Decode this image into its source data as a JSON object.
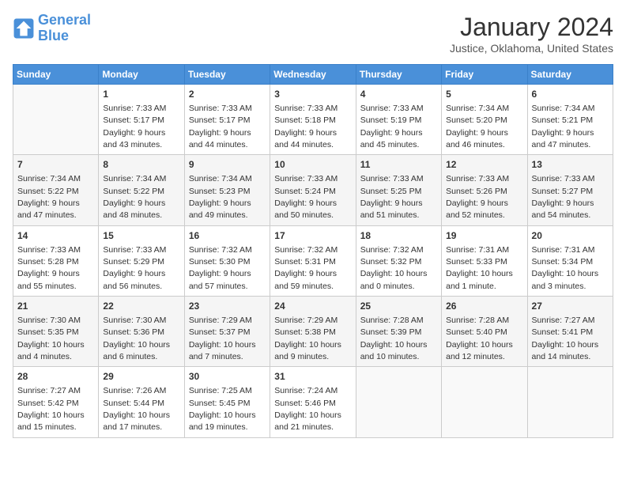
{
  "header": {
    "logo": {
      "line1": "General",
      "line2": "Blue"
    },
    "title": "January 2024",
    "location": "Justice, Oklahoma, United States"
  },
  "days_of_week": [
    "Sunday",
    "Monday",
    "Tuesday",
    "Wednesday",
    "Thursday",
    "Friday",
    "Saturday"
  ],
  "weeks": [
    [
      {
        "num": "",
        "sunrise": "",
        "sunset": "",
        "daylight": "",
        "empty": true
      },
      {
        "num": "1",
        "sunrise": "Sunrise: 7:33 AM",
        "sunset": "Sunset: 5:17 PM",
        "daylight": "Daylight: 9 hours and 43 minutes."
      },
      {
        "num": "2",
        "sunrise": "Sunrise: 7:33 AM",
        "sunset": "Sunset: 5:17 PM",
        "daylight": "Daylight: 9 hours and 44 minutes."
      },
      {
        "num": "3",
        "sunrise": "Sunrise: 7:33 AM",
        "sunset": "Sunset: 5:18 PM",
        "daylight": "Daylight: 9 hours and 44 minutes."
      },
      {
        "num": "4",
        "sunrise": "Sunrise: 7:33 AM",
        "sunset": "Sunset: 5:19 PM",
        "daylight": "Daylight: 9 hours and 45 minutes."
      },
      {
        "num": "5",
        "sunrise": "Sunrise: 7:34 AM",
        "sunset": "Sunset: 5:20 PM",
        "daylight": "Daylight: 9 hours and 46 minutes."
      },
      {
        "num": "6",
        "sunrise": "Sunrise: 7:34 AM",
        "sunset": "Sunset: 5:21 PM",
        "daylight": "Daylight: 9 hours and 47 minutes."
      }
    ],
    [
      {
        "num": "7",
        "sunrise": "Sunrise: 7:34 AM",
        "sunset": "Sunset: 5:22 PM",
        "daylight": "Daylight: 9 hours and 47 minutes."
      },
      {
        "num": "8",
        "sunrise": "Sunrise: 7:34 AM",
        "sunset": "Sunset: 5:22 PM",
        "daylight": "Daylight: 9 hours and 48 minutes."
      },
      {
        "num": "9",
        "sunrise": "Sunrise: 7:34 AM",
        "sunset": "Sunset: 5:23 PM",
        "daylight": "Daylight: 9 hours and 49 minutes."
      },
      {
        "num": "10",
        "sunrise": "Sunrise: 7:33 AM",
        "sunset": "Sunset: 5:24 PM",
        "daylight": "Daylight: 9 hours and 50 minutes."
      },
      {
        "num": "11",
        "sunrise": "Sunrise: 7:33 AM",
        "sunset": "Sunset: 5:25 PM",
        "daylight": "Daylight: 9 hours and 51 minutes."
      },
      {
        "num": "12",
        "sunrise": "Sunrise: 7:33 AM",
        "sunset": "Sunset: 5:26 PM",
        "daylight": "Daylight: 9 hours and 52 minutes."
      },
      {
        "num": "13",
        "sunrise": "Sunrise: 7:33 AM",
        "sunset": "Sunset: 5:27 PM",
        "daylight": "Daylight: 9 hours and 54 minutes."
      }
    ],
    [
      {
        "num": "14",
        "sunrise": "Sunrise: 7:33 AM",
        "sunset": "Sunset: 5:28 PM",
        "daylight": "Daylight: 9 hours and 55 minutes."
      },
      {
        "num": "15",
        "sunrise": "Sunrise: 7:33 AM",
        "sunset": "Sunset: 5:29 PM",
        "daylight": "Daylight: 9 hours and 56 minutes."
      },
      {
        "num": "16",
        "sunrise": "Sunrise: 7:32 AM",
        "sunset": "Sunset: 5:30 PM",
        "daylight": "Daylight: 9 hours and 57 minutes."
      },
      {
        "num": "17",
        "sunrise": "Sunrise: 7:32 AM",
        "sunset": "Sunset: 5:31 PM",
        "daylight": "Daylight: 9 hours and 59 minutes."
      },
      {
        "num": "18",
        "sunrise": "Sunrise: 7:32 AM",
        "sunset": "Sunset: 5:32 PM",
        "daylight": "Daylight: 10 hours and 0 minutes."
      },
      {
        "num": "19",
        "sunrise": "Sunrise: 7:31 AM",
        "sunset": "Sunset: 5:33 PM",
        "daylight": "Daylight: 10 hours and 1 minute."
      },
      {
        "num": "20",
        "sunrise": "Sunrise: 7:31 AM",
        "sunset": "Sunset: 5:34 PM",
        "daylight": "Daylight: 10 hours and 3 minutes."
      }
    ],
    [
      {
        "num": "21",
        "sunrise": "Sunrise: 7:30 AM",
        "sunset": "Sunset: 5:35 PM",
        "daylight": "Daylight: 10 hours and 4 minutes."
      },
      {
        "num": "22",
        "sunrise": "Sunrise: 7:30 AM",
        "sunset": "Sunset: 5:36 PM",
        "daylight": "Daylight: 10 hours and 6 minutes."
      },
      {
        "num": "23",
        "sunrise": "Sunrise: 7:29 AM",
        "sunset": "Sunset: 5:37 PM",
        "daylight": "Daylight: 10 hours and 7 minutes."
      },
      {
        "num": "24",
        "sunrise": "Sunrise: 7:29 AM",
        "sunset": "Sunset: 5:38 PM",
        "daylight": "Daylight: 10 hours and 9 minutes."
      },
      {
        "num": "25",
        "sunrise": "Sunrise: 7:28 AM",
        "sunset": "Sunset: 5:39 PM",
        "daylight": "Daylight: 10 hours and 10 minutes."
      },
      {
        "num": "26",
        "sunrise": "Sunrise: 7:28 AM",
        "sunset": "Sunset: 5:40 PM",
        "daylight": "Daylight: 10 hours and 12 minutes."
      },
      {
        "num": "27",
        "sunrise": "Sunrise: 7:27 AM",
        "sunset": "Sunset: 5:41 PM",
        "daylight": "Daylight: 10 hours and 14 minutes."
      }
    ],
    [
      {
        "num": "28",
        "sunrise": "Sunrise: 7:27 AM",
        "sunset": "Sunset: 5:42 PM",
        "daylight": "Daylight: 10 hours and 15 minutes."
      },
      {
        "num": "29",
        "sunrise": "Sunrise: 7:26 AM",
        "sunset": "Sunset: 5:44 PM",
        "daylight": "Daylight: 10 hours and 17 minutes."
      },
      {
        "num": "30",
        "sunrise": "Sunrise: 7:25 AM",
        "sunset": "Sunset: 5:45 PM",
        "daylight": "Daylight: 10 hours and 19 minutes."
      },
      {
        "num": "31",
        "sunrise": "Sunrise: 7:24 AM",
        "sunset": "Sunset: 5:46 PM",
        "daylight": "Daylight: 10 hours and 21 minutes."
      },
      {
        "num": "",
        "sunrise": "",
        "sunset": "",
        "daylight": "",
        "empty": true
      },
      {
        "num": "",
        "sunrise": "",
        "sunset": "",
        "daylight": "",
        "empty": true
      },
      {
        "num": "",
        "sunrise": "",
        "sunset": "",
        "daylight": "",
        "empty": true
      }
    ]
  ]
}
